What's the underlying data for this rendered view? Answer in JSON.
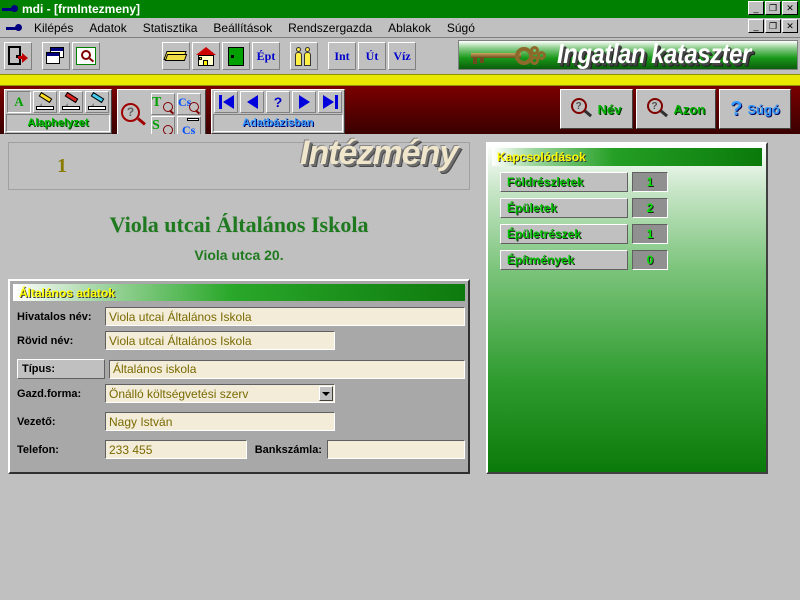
{
  "window": {
    "title": "mdi - [frmIntezmeny]",
    "controls": {
      "minimize": "_",
      "restore": "❐",
      "close": "✕"
    }
  },
  "menu": {
    "items": [
      {
        "label": "Kilépés"
      },
      {
        "label": "Adatok"
      },
      {
        "label": "Statisztika"
      },
      {
        "label": "Beállítások"
      },
      {
        "label": "Rendszergazda"
      },
      {
        "label": "Ablakok"
      },
      {
        "label": "Súgó"
      }
    ]
  },
  "toolbar": {
    "buttons": [
      {
        "icon": "exit-door-icon",
        "label": ""
      },
      {
        "icon": "windows-cascade-icon",
        "label": ""
      },
      {
        "icon": "search-window-icon",
        "label": ""
      },
      {
        "icon": "book-icon",
        "label": ""
      },
      {
        "icon": "house-icon",
        "label": ""
      },
      {
        "icon": "green-door-icon",
        "label": ""
      },
      {
        "icon": "text-icon",
        "label": "Épt"
      },
      {
        "icon": "people-icon",
        "label": ""
      },
      {
        "icon": "text-icon",
        "label": "Int"
      },
      {
        "icon": "text-icon",
        "label": "Út"
      },
      {
        "icon": "text-icon",
        "label": "Víz"
      }
    ]
  },
  "banner": {
    "title": "Ingatlan kataszter",
    "icon": "key-icon"
  },
  "actionbar": {
    "edit_group": {
      "label": "Alaphelyzet",
      "buttons": [
        {
          "name": "mode-a",
          "text": "A"
        },
        {
          "name": "pen-yellow",
          "text": ""
        },
        {
          "name": "pen-red",
          "text": ""
        },
        {
          "name": "pen-blue",
          "text": ""
        }
      ]
    },
    "search_group": {
      "magnifier": "?",
      "buttons": [
        {
          "name": "search-t",
          "letter": "T",
          "color": "green"
        },
        {
          "name": "search-cs",
          "letter": "Cs",
          "color": "blue"
        },
        {
          "name": "search-s",
          "letter": "S",
          "color": "green"
        },
        {
          "name": "search-cs-bar",
          "letter": "Cs",
          "color": "blue"
        }
      ]
    },
    "nav_group": {
      "label": "Adatbázisban",
      "buttons": [
        {
          "name": "nav-first"
        },
        {
          "name": "nav-prev"
        },
        {
          "name": "nav-help",
          "text": "?"
        },
        {
          "name": "nav-next"
        },
        {
          "name": "nav-last"
        }
      ]
    },
    "right_buttons": [
      {
        "name": "search-by-name",
        "label": "Név",
        "icon": "magnifier-question-icon",
        "color_key": "green"
      },
      {
        "name": "search-by-id",
        "label": "Azon",
        "icon": "magnifier-question-icon",
        "color_key": "green"
      },
      {
        "name": "help",
        "label": "Súgó",
        "icon": "question-mark-icon",
        "color_key": "blue"
      }
    ]
  },
  "record": {
    "entity_title": "Intézmény",
    "record_number": "1",
    "institution_name": "Viola utcai Általános Iskola",
    "address": "Viola utca  20."
  },
  "form": {
    "section_title": "Általános adatok",
    "fields": [
      {
        "label": "Hivatalos név:",
        "value": "Viola utcai Általános Iskola"
      },
      {
        "label": "Rövid név:",
        "value": "Viola utcai Általános Iskola"
      },
      {
        "label": "Típus:",
        "value": "Általános iskola"
      },
      {
        "label": "Gazd.forma:",
        "value": "Önálló költségvetési szerv"
      },
      {
        "label": "Vezető:",
        "value": "Nagy István"
      },
      {
        "label": "Telefon:",
        "value": "233 455"
      },
      {
        "label": "Bankszámla:",
        "value": ""
      }
    ]
  },
  "relations": {
    "title": "Kapcsolódások",
    "rows": [
      {
        "label": "Földrészletek",
        "count": "1"
      },
      {
        "label": "Épületek",
        "count": "2"
      },
      {
        "label": "Épületrészek",
        "count": "1"
      },
      {
        "label": "Építmények",
        "count": "0"
      }
    ]
  },
  "colors": {
    "title_bar": "#008000",
    "accent_yellow": "#e8e800",
    "toolbar_dark": "#5a0000",
    "panel_green": "#0a7a0a",
    "field_bg": "#f2ecd8",
    "field_text": "#7a6a00",
    "heading_green": "#1f7a1f"
  }
}
